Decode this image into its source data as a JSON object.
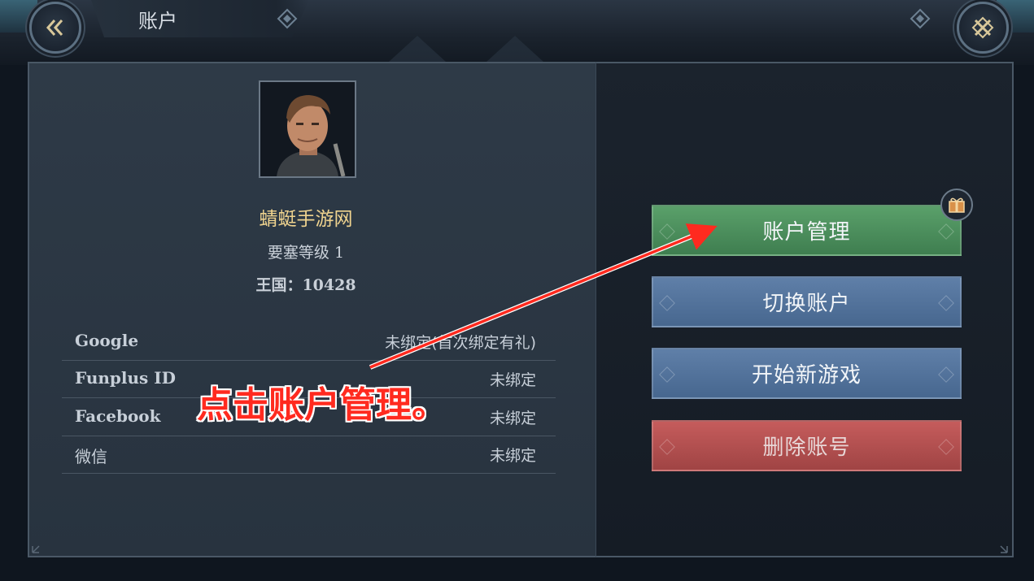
{
  "header": {
    "title": "账户",
    "back_icon": "chevron-double-left-icon",
    "close_icon": "close-icon"
  },
  "profile": {
    "name": "蜻蜓手游网",
    "fort_level": "要塞等级 1",
    "kingdom": "王国：10428"
  },
  "bindings": [
    {
      "platform": "Google",
      "status": "未绑定(首次绑定有礼)"
    },
    {
      "platform": "Funplus ID",
      "status": "未绑定"
    },
    {
      "platform": "Facebook",
      "status": "未绑定"
    },
    {
      "platform": "微信",
      "status": "未绑定"
    }
  ],
  "actions": {
    "manage": "账户管理",
    "switch": "切换账户",
    "new_game": "开始新游戏",
    "delete": "删除账号"
  },
  "annotation": {
    "text": "点击账户管理。"
  },
  "colors": {
    "manage_button": "#4f9060",
    "switch_button": "#5576a0",
    "new_game_button": "#5576a0",
    "delete_button": "#b45050",
    "player_name": "#f0d48f",
    "annotation": "#ff2a1f"
  }
}
